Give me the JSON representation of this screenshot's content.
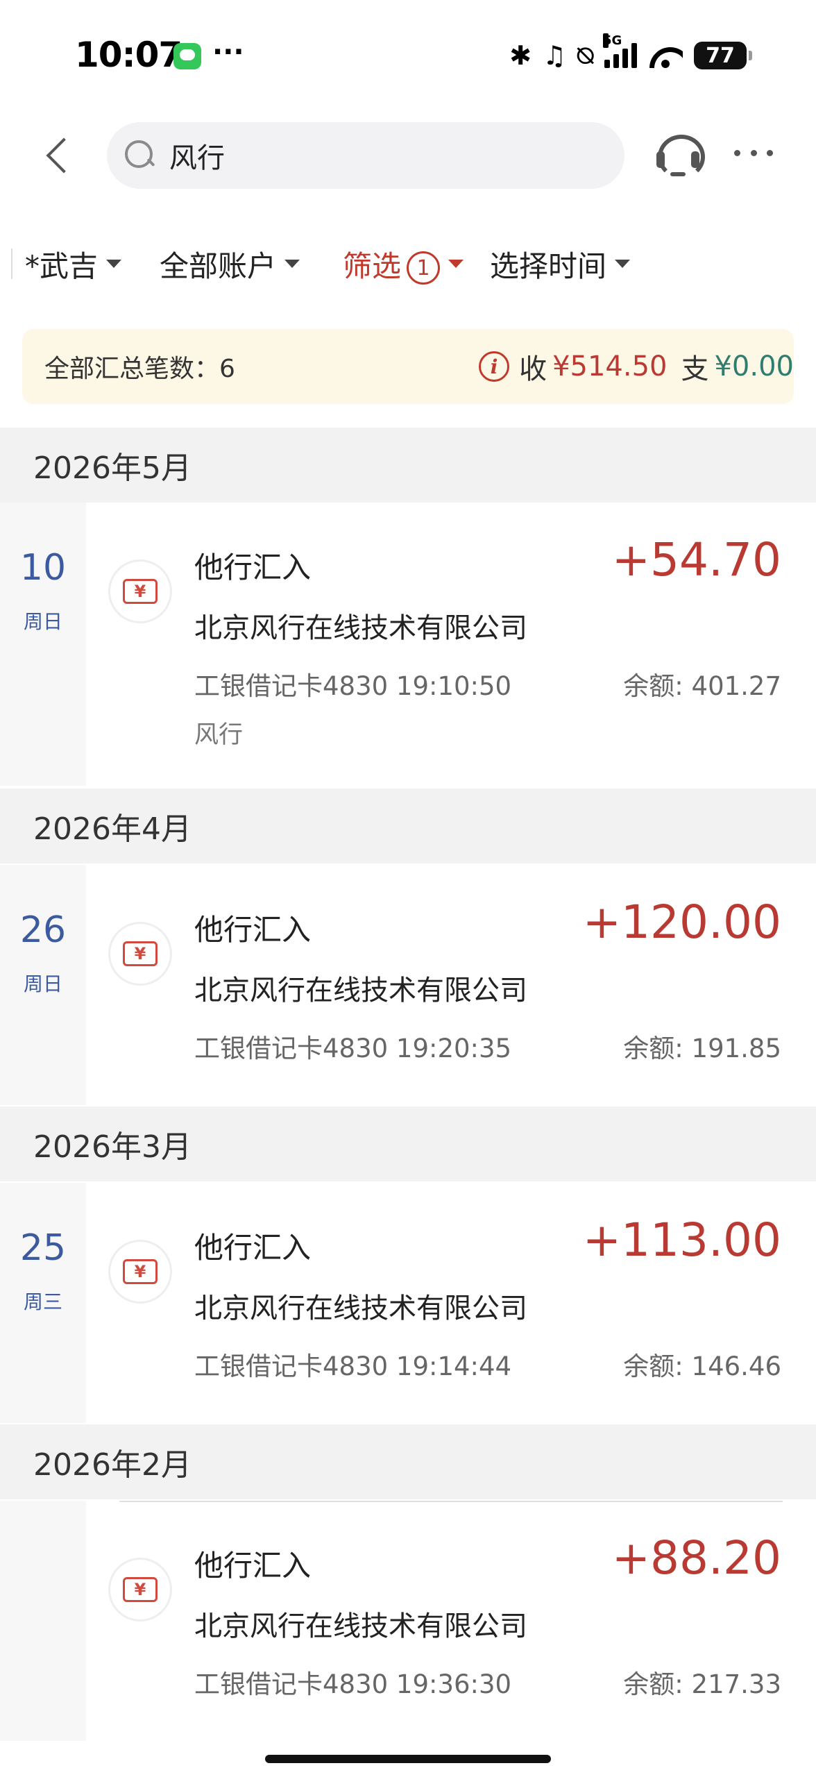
{
  "status_bar": {
    "time": "10:07",
    "dots": "···",
    "network": "5G",
    "battery": "77"
  },
  "search": {
    "query": "风行",
    "placeholder": ""
  },
  "filters": {
    "person": "*武吉",
    "account": "全部账户",
    "filter_label": "筛选",
    "filter_count": "1",
    "time": "选择时间"
  },
  "summary": {
    "count_label": "全部汇总笔数：6",
    "income_label": "收",
    "income": "¥514.50",
    "expense_label": "支",
    "expense": "¥0.00"
  },
  "colors": {
    "accent_red": "#b93a32",
    "date_blue": "#3b5aa0",
    "expense_green": "#2e7d6e",
    "summary_bg": "#fdf8e6"
  },
  "groups": [
    {
      "month": "2026年5月",
      "transactions": [
        {
          "day": "10",
          "weekday": "周日",
          "title": "他行汇入",
          "amount": "+54.70",
          "company": "北京风行在线技术有限公司",
          "card": "工银借记卡4830  19:10:50",
          "balance": "余额: 401.27",
          "note": "风行"
        }
      ]
    },
    {
      "month": "2026年4月",
      "transactions": [
        {
          "day": "26",
          "weekday": "周日",
          "title": "他行汇入",
          "amount": "+120.00",
          "company": "北京风行在线技术有限公司",
          "card": "工银借记卡4830  19:20:35",
          "balance": "余额: 191.85"
        }
      ]
    },
    {
      "month": "2026年3月",
      "transactions": [
        {
          "day": "25",
          "weekday": "周三",
          "title": "他行汇入",
          "amount": "+113.00",
          "company": "北京风行在线技术有限公司",
          "card": "工银借记卡4830  19:14:44",
          "balance": "余额: 146.46"
        }
      ]
    },
    {
      "month": "2026年2月",
      "transactions": [
        {
          "title": "他行汇入",
          "amount": "+88.20",
          "company": "北京风行在线技术有限公司",
          "card": "工银借记卡4830  19:36:30",
          "balance": "余额: 217.33"
        }
      ]
    }
  ]
}
